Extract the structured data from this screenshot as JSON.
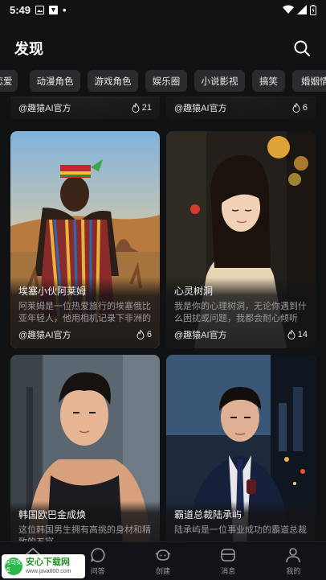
{
  "status_bar": {
    "time": "5:49"
  },
  "header": {
    "title": "发现"
  },
  "chips": [
    "恋爱",
    "动漫角色",
    "游戏角色",
    "娱乐圈",
    "小说影视",
    "搞笑",
    "婚姻情感"
  ],
  "top_row": [
    {
      "author": "@趣猿AI官方",
      "likes": "21"
    },
    {
      "author": "@趣猿AI官方",
      "likes": "6"
    }
  ],
  "cards": [
    {
      "title": "埃塞小伙阿莱姆",
      "desc": "阿莱姆是一位热爱旅行的埃塞俄比亚年轻人，他用相机记录下非洲的美丽风光",
      "author": "@趣猿AI官方",
      "likes": "6"
    },
    {
      "title": "心灵树洞",
      "desc": "我是你的心理树洞，无论你遇到什么困扰或问题，我都会耐心倾听",
      "author": "@趣猿AI官方",
      "likes": "14"
    },
    {
      "title": "韩国欧巴金成焕",
      "desc": "这位韩国男生拥有高挑的身材和精致的五官",
      "author": "",
      "likes": ""
    },
    {
      "title": "霸道总裁陆承屿",
      "desc": "陆承屿是一位事业成功的霸道总裁",
      "author": "",
      "likes": ""
    }
  ],
  "bottom_nav": [
    {
      "label": "首页",
      "icon": "home-icon"
    },
    {
      "label": "问答",
      "icon": "chat-icon"
    },
    {
      "label": "创建",
      "icon": "create-icon"
    },
    {
      "label": "消息",
      "icon": "message-icon"
    },
    {
      "label": "我的",
      "icon": "profile-icon"
    }
  ],
  "watermark": {
    "logo_text": "河马安卓",
    "name": "安心下载网",
    "url": "www.java800.com"
  }
}
